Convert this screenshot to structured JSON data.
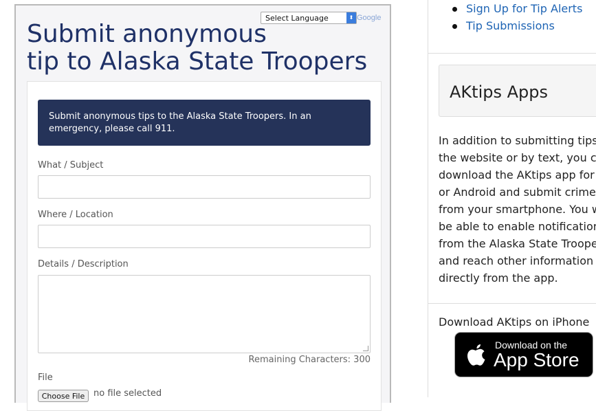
{
  "left": {
    "language_select": "Select Language",
    "google_label": "Google",
    "title_line1": "Submit anonymous",
    "title_line2": "tip to Alaska State Troopers",
    "alert": "Submit anonymous tips to the Alaska State Troopers. In an emergency, please call 911.",
    "fields": {
      "subject_label": "What / Subject",
      "location_label": "Where / Location",
      "details_label": "Details / Description",
      "remaining_label": "Remaining Characters: 300",
      "file_label": "File",
      "file_button": "Choose File",
      "file_status": "no file selected"
    }
  },
  "right": {
    "links": [
      "Sign Up for Tip Alerts",
      "Tip Submissions"
    ],
    "apps_title": "AKtips Apps",
    "apps_body": [
      "In addition to submitting tips o",
      "the website or by text, you can",
      "download the AKtips app for iO",
      "or Android and submit crime ti",
      "from your smartphone. You wil",
      "be able to enable notifications",
      "from the Alaska State Troopers",
      "and reach other information",
      "directly from the app."
    ],
    "download_label": "Download AKtips on iPhone",
    "badge_small": "Download on the",
    "badge_big": "App Store"
  },
  "colors": {
    "title": "#1f3167",
    "alert_bg": "#253359",
    "link": "#1e64b4"
  }
}
